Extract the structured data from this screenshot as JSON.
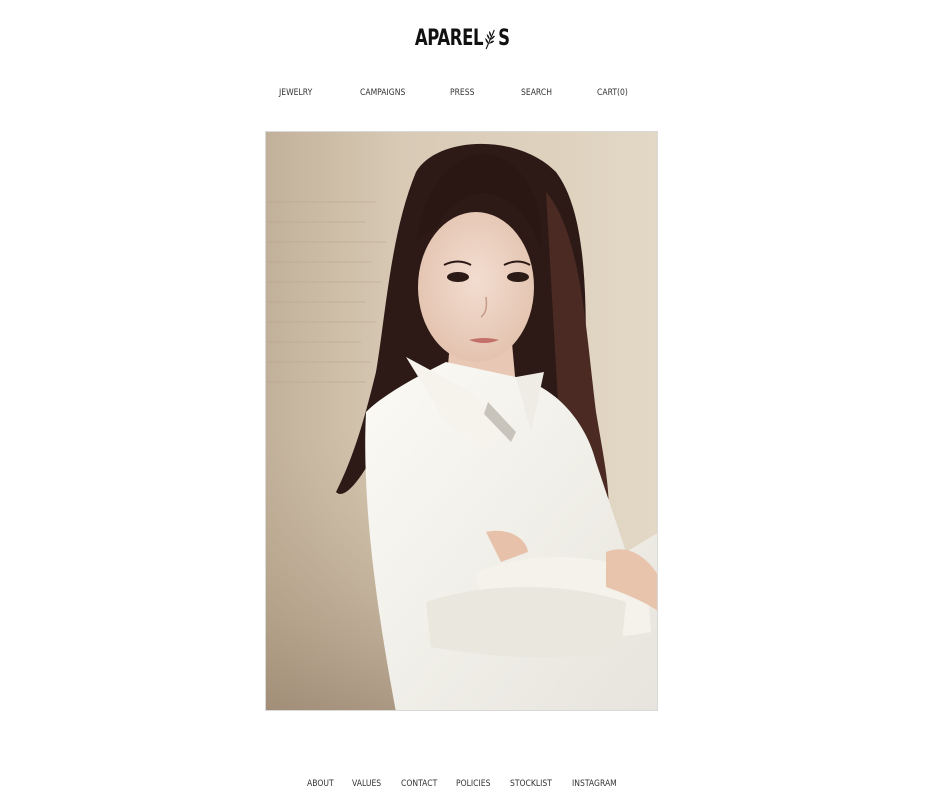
{
  "brand": {
    "name_left": "APAREL",
    "name_right": "S"
  },
  "nav": {
    "items": [
      {
        "label": "JEWELRY"
      },
      {
        "label": "CAMPAIGNS"
      },
      {
        "label": "PRESS"
      },
      {
        "label": "SEARCH"
      },
      {
        "label": "CART(0)"
      }
    ]
  },
  "hero": {
    "image": "portrait-photo"
  },
  "footer": {
    "items": [
      {
        "label": "ABOUT"
      },
      {
        "label": "VALUES"
      },
      {
        "label": "CONTACT"
      },
      {
        "label": "POLICIES"
      },
      {
        "label": "STOCKLIST"
      },
      {
        "label": "INSTAGRAM"
      }
    ]
  },
  "colors": {
    "background": "#ffffff",
    "text": "#333333",
    "logo": "#111111"
  }
}
